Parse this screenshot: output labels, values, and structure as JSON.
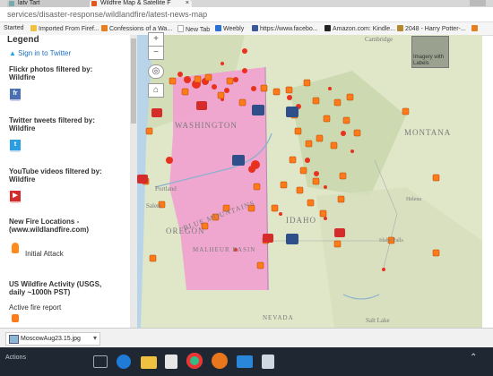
{
  "browser": {
    "tabs": [
      {
        "label": "latv Tart",
        "close": "×"
      },
      {
        "label": "Wildfire Map & Satellite F",
        "close": "×"
      }
    ],
    "url": "services/disaster-response/wildlandfire/latest-news-map",
    "bookmarks": [
      {
        "label": "Started",
        "color": "#fff"
      },
      {
        "label": "Imported From Firef...",
        "color": "#f0c040"
      },
      {
        "label": "Confessions of a Wa...",
        "color": "#e67e22"
      },
      {
        "label": "New Tab",
        "color": "#ddd"
      },
      {
        "label": "Weebly",
        "color": "#2a6fd6"
      },
      {
        "label": "https://www.facebo...",
        "color": "#3b5998"
      },
      {
        "label": "Amazon.com: Kindle...",
        "color": "#222"
      },
      {
        "label": "2048 - Harry Potter-...",
        "color": "#b5892f"
      }
    ]
  },
  "panel": {
    "legend_title": "Legend",
    "twitter_signin": "Sign in to Twitter",
    "flickr_heading": [
      "Flickr photos filtered by:",
      "Wildfire"
    ],
    "twitter_heading": [
      "Twitter tweets filtered by:",
      "Wildfire"
    ],
    "youtube_heading": [
      "YouTube videos filtered by:",
      "Wildfire"
    ],
    "newfire_heading": [
      "New Fire Locations -",
      "(www.wildlandfire.com)"
    ],
    "initial_attack": "Initial Attack",
    "usgs_heading": [
      "US Wildfire Activity (USGS,",
      "daily ~1000h PST)"
    ],
    "active_fire": "Active fire report"
  },
  "map": {
    "labels": {
      "washington": "WASHINGTON",
      "oregon": "OREGON",
      "blue_mountains": "BLUE MOUNTAINS",
      "idaho": "IDAHO",
      "montana": "MONTANA",
      "portland": "Portland",
      "salem": "Salem",
      "malheur_basin": "MALHEUR BASIN",
      "salt_lake": "Salt Lake",
      "cambridge": "Cambridge",
      "idaho_falls": "Idaho Falls",
      "helena": "Helena",
      "nevada": "NEVADA"
    },
    "imagery_label": [
      "Imagery with",
      "Labels"
    ],
    "zoom_in": "+",
    "zoom_out": "−",
    "home": "⌂",
    "colors": {
      "water": "#b8d4e8",
      "terrain": "#dfe7c8",
      "highlight": "#f39bd0",
      "fire": "#e8321f",
      "fire_icon": "#ff7a18"
    }
  },
  "download": {
    "filename": "MoscowAug23.15.jpg",
    "menu": "▾"
  },
  "taskbar": {
    "actions": "Actions"
  }
}
